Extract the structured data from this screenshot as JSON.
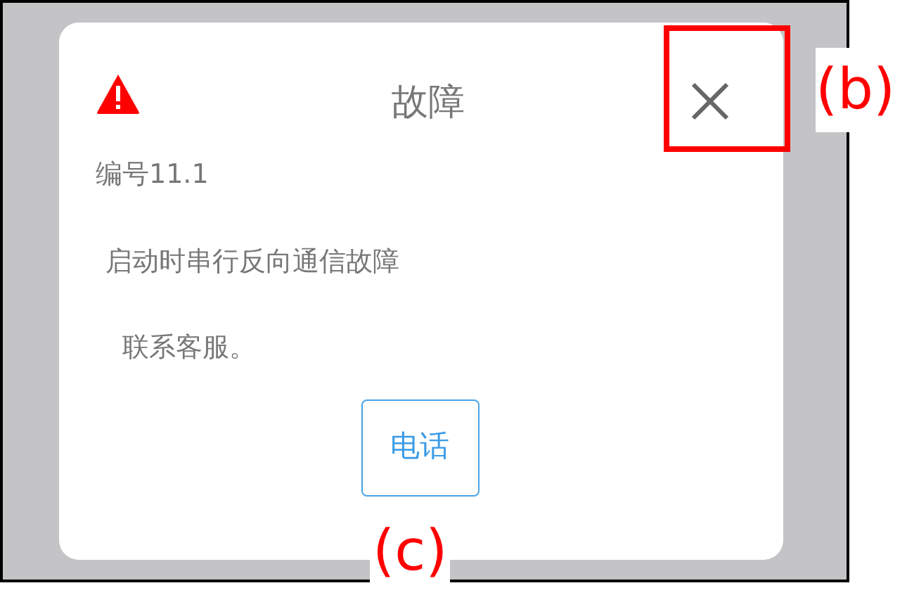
{
  "dialog": {
    "title": "故障",
    "lines": [
      {
        "text": "编号11.1"
      },
      {
        "text": "启动时串行反向通信故障"
      },
      {
        "text": " 联系客服。"
      }
    ],
    "button": "电话"
  },
  "annotations": [
    {
      "kind": "callout",
      "label": "(b)"
    },
    {
      "kind": "caption",
      "label": "(c)"
    }
  ]
}
